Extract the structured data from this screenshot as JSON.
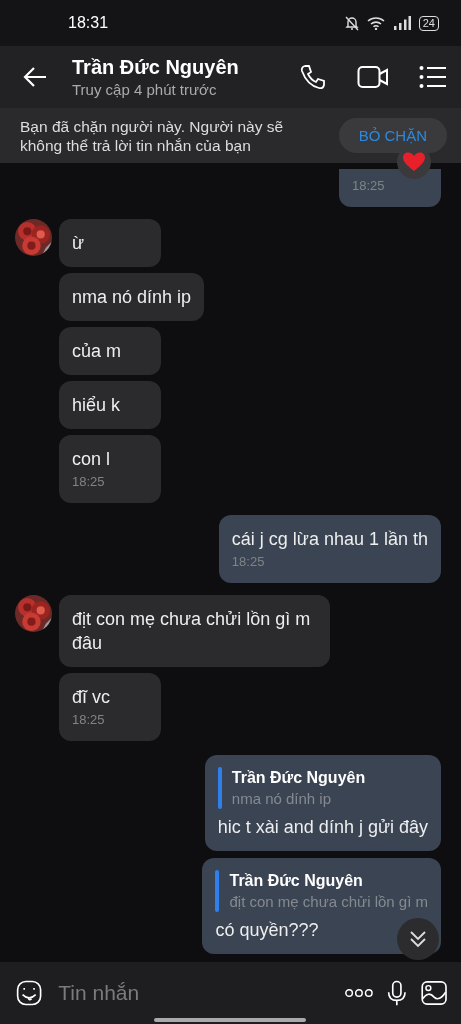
{
  "status_bar": {
    "time": "18:31",
    "battery": "24"
  },
  "header": {
    "name": "Trần Đức Nguyên",
    "status": "Truy cập 4 phút trước"
  },
  "blocked_banner": {
    "text": "Bạn đã chặn người này. Người này sẽ không thể trả lời tin nhắn của bạn",
    "button": "BỎ CHẶN"
  },
  "messages": [
    {
      "kind": "outgoing",
      "time": "18:25",
      "reacted": true
    },
    {
      "kind": "incoming",
      "text": "ừ",
      "avatar": true
    },
    {
      "kind": "incoming",
      "text": "nma nó dính ip"
    },
    {
      "kind": "incoming",
      "text": "của m"
    },
    {
      "kind": "incoming",
      "text": "hiểu k"
    },
    {
      "kind": "incoming",
      "text": "con l",
      "time": "18:25"
    },
    {
      "kind": "outgoing",
      "text": "cái j cg lừa nhau 1 lần th",
      "time": "18:25"
    },
    {
      "kind": "incoming",
      "text": "địt con mẹ chưa chửi lồn gì m đâu",
      "avatar": true
    },
    {
      "kind": "incoming",
      "text": "đĩ vc",
      "time": "18:25"
    },
    {
      "kind": "reply",
      "quote_name": "Trần Đức Nguyên",
      "quote_text": "nma nó dính ip",
      "text": "hic t xài and dính j gửi đây"
    },
    {
      "kind": "reply",
      "quote_name": "Trần Đức Nguyên",
      "quote_text": "địt con mẹ chưa chửi lồn gì m",
      "text": "có quyền???"
    }
  ],
  "composer": {
    "placeholder": "Tin nhắn"
  }
}
